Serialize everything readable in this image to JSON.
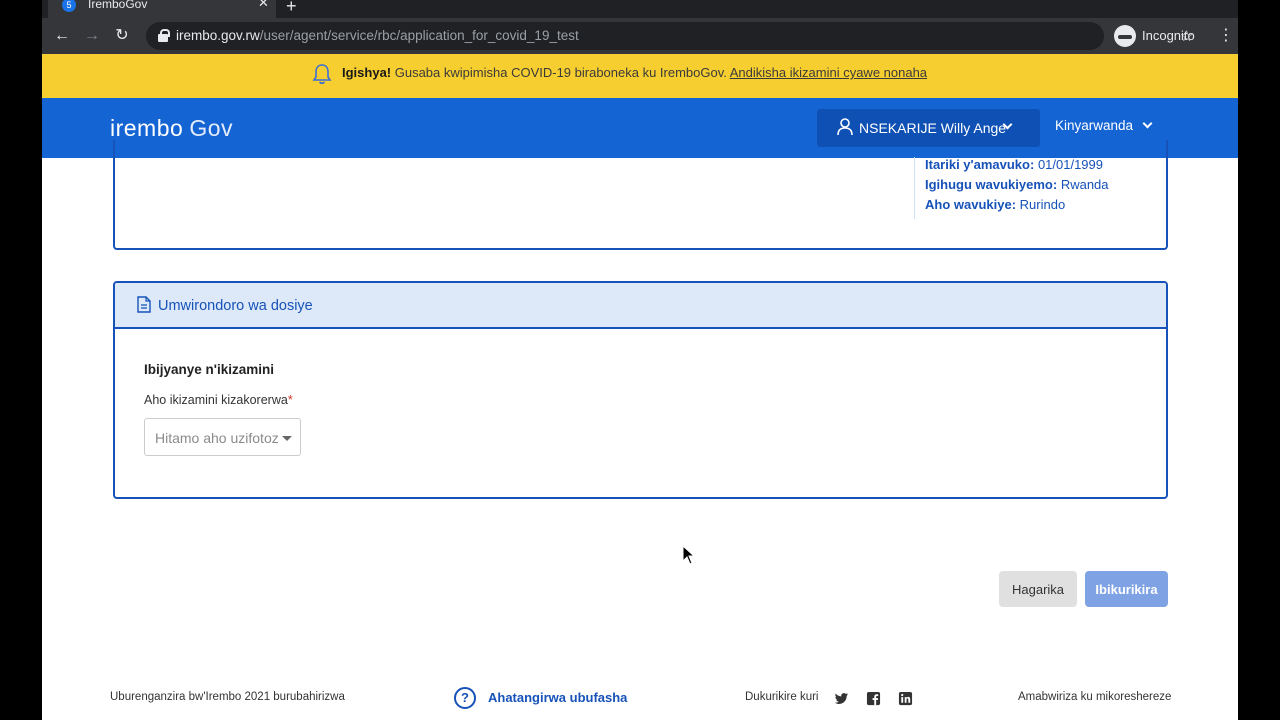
{
  "browser": {
    "tab_title": "IremboGov",
    "tab_favicon": "5",
    "url_host": "irembo.gov.rw",
    "url_path": "/user/agent/service/rbc/application_for_covid_19_test",
    "profile_label": "Incognito"
  },
  "banner": {
    "bold": "Igishya!",
    "text": " Gusaba kwipimisha COVID-19 biraboneka ku IremboGov. ",
    "link": "Andikisha ikizamini cyawe nonaha",
    "color": "#f7ce2f"
  },
  "header": {
    "logo_main": "irembo",
    "logo_gov": "Gov",
    "user_name": "NSEKARIJE Willy Ange",
    "language": "Kinyarwanda",
    "color": "#1564d4"
  },
  "applicant": {
    "rows": [
      {
        "label": "Itariki y'amavuko:",
        "value": "01/01/1999"
      },
      {
        "label": "Igihugu wavukiyemo:",
        "value": "Rwanda"
      },
      {
        "label": "Aho wavukiye:",
        "value": "Rurindo"
      }
    ]
  },
  "form": {
    "card_title": "Umwirondoro wa dosiye",
    "section_title": "Ibijyanye n'ikizamini",
    "field_label": "Aho ikizamini kizakorerwa",
    "required_mark": "*",
    "select_placeholder": "Hitamo aho uzifotoza"
  },
  "actions": {
    "cancel": "Hagarika",
    "submit": "Ibikurikira"
  },
  "footer": {
    "copyright": "Uburenganzira bw'Irembo 2021 burubahirizwa",
    "help_icon": "?",
    "help_label": "Ahatangirwa ubufasha",
    "follow_label": "Dukurikire kuri",
    "social": [
      "twitter-icon",
      "facebook-icon",
      "linkedin-icon"
    ],
    "right_text": "Amabwiriza ku mikoreshereze"
  }
}
